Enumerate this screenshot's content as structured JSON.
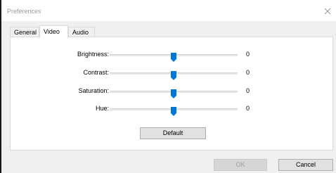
{
  "window": {
    "title": "Preferences"
  },
  "tabs": [
    {
      "label": "General",
      "active": false
    },
    {
      "label": "Video",
      "active": true
    },
    {
      "label": "Audio",
      "active": false
    }
  ],
  "sliders": [
    {
      "label": "Brightness:",
      "value": "0",
      "position": 0.5
    },
    {
      "label": "Contrast:",
      "value": "0",
      "position": 0.5
    },
    {
      "label": "Saturation:",
      "value": "0",
      "position": 0.5
    },
    {
      "label": "Hue:",
      "value": "0",
      "position": 0.5
    }
  ],
  "buttons": {
    "default_label": "Default",
    "ok_label": "OK",
    "cancel_label": "Cancel",
    "ok_enabled": false
  },
  "colors": {
    "accent": "#0078d7"
  }
}
